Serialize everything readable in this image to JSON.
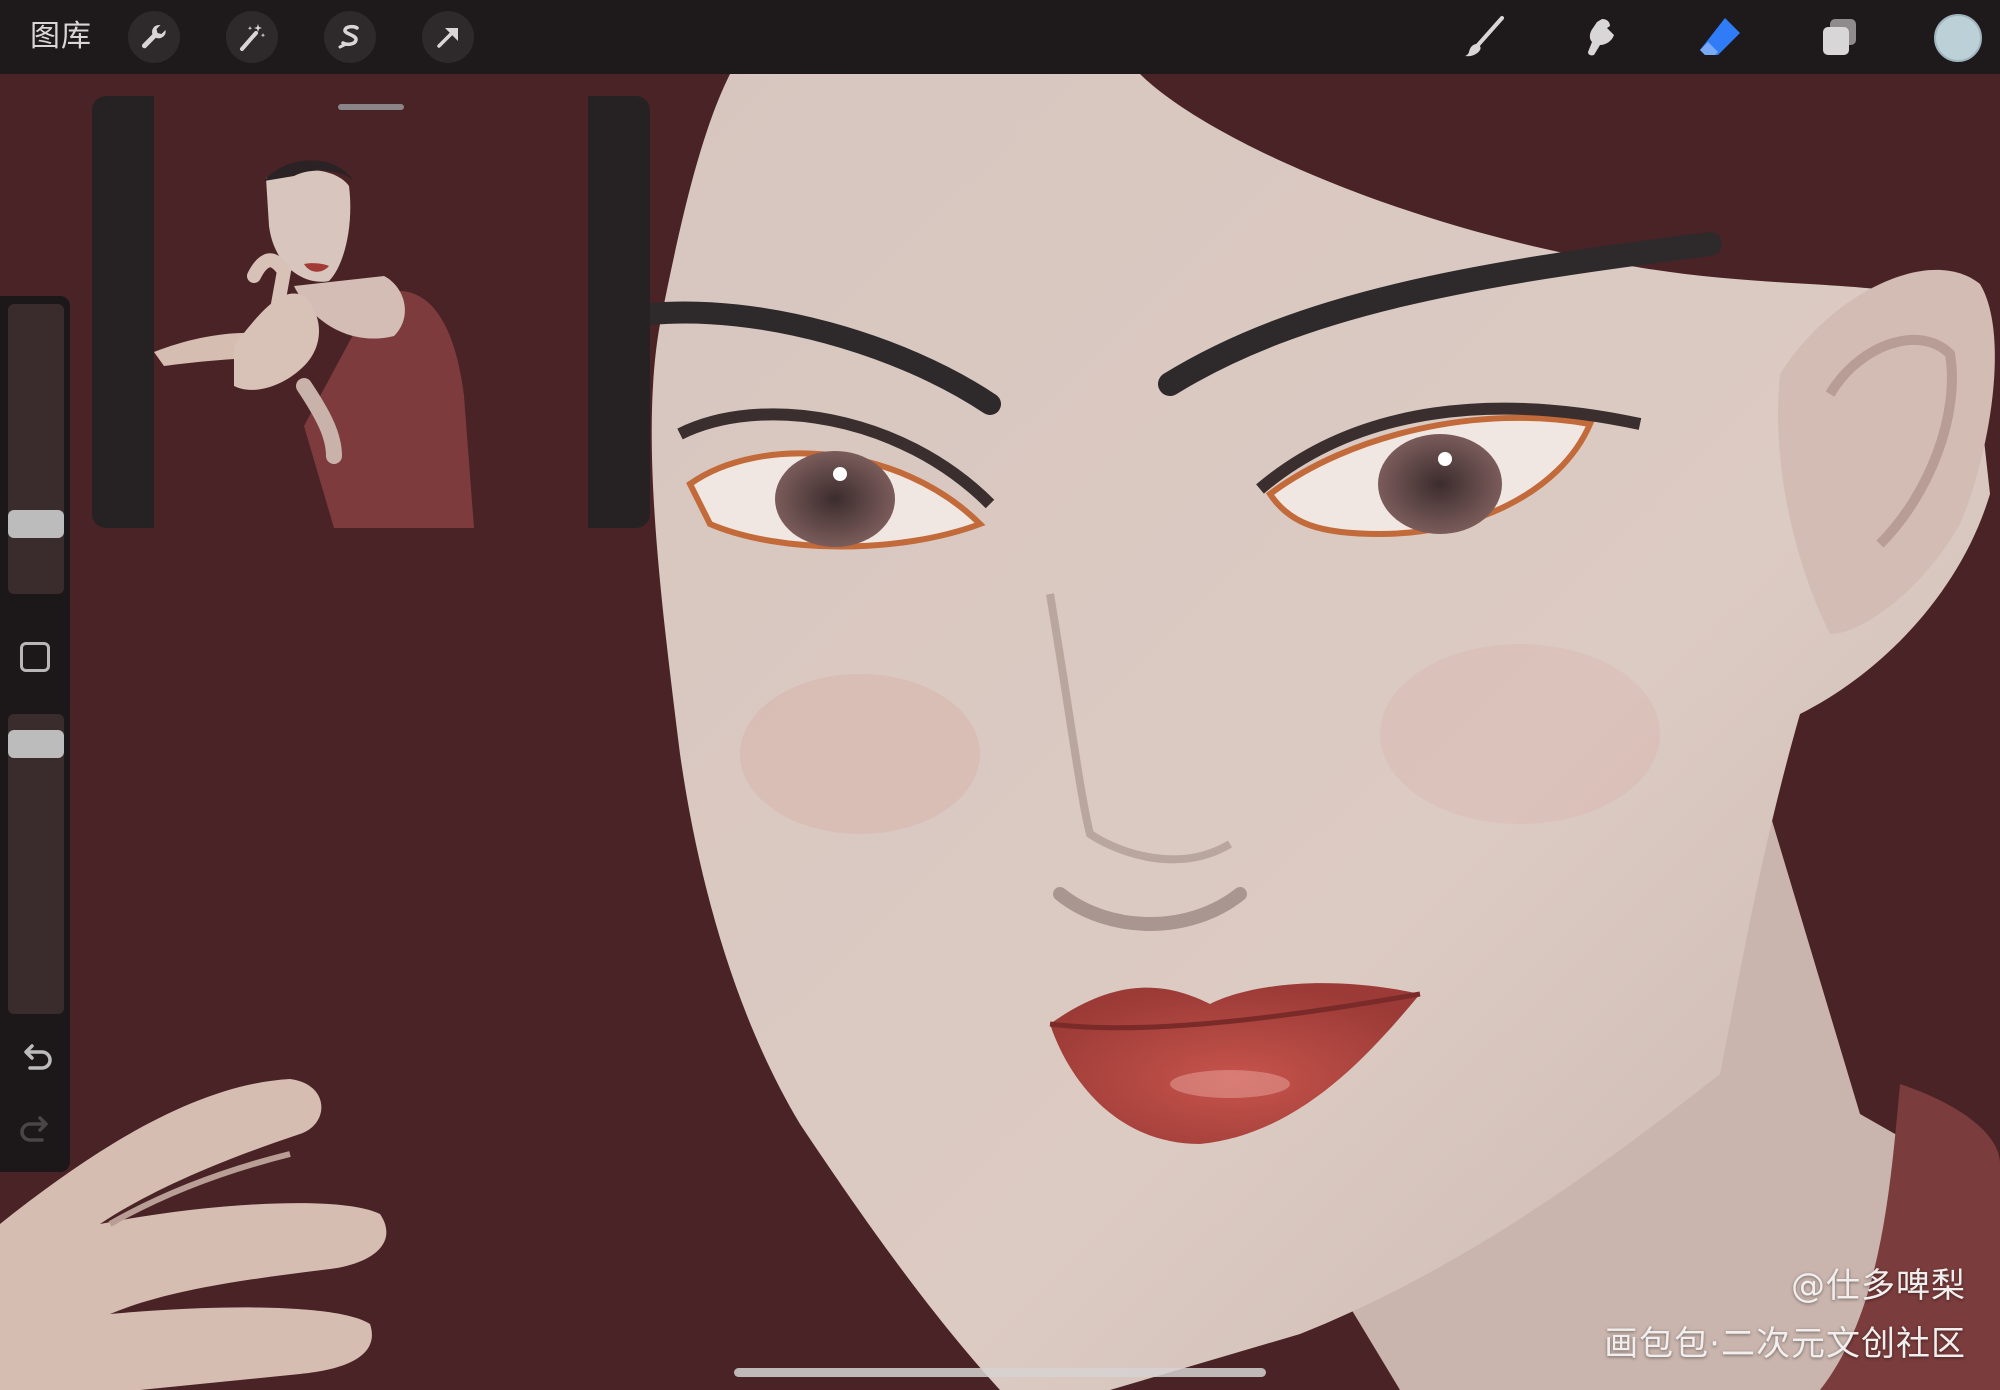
{
  "app": {
    "gallery_label": "图库"
  },
  "toolbar": {
    "left_tools": [
      "wrench-icon",
      "magic-wand-icon",
      "selection-s-icon",
      "move-arrow-icon"
    ],
    "right_tools": [
      "brush-icon",
      "smudge-icon",
      "eraser-icon",
      "layers-icon",
      "color-icon"
    ],
    "active_tool": "eraser",
    "accent": "#2f7cf6",
    "current_color": "#bcd0d8"
  },
  "sidebar": {
    "brush_size_level": 0.24,
    "opacity_level": 0.92,
    "modify_button_icon": "square-icon",
    "undo_icon": "undo-icon",
    "redo_icon": "redo-icon"
  },
  "canvas": {
    "background": "#4a2326"
  },
  "reference": {
    "window_label": "reference-preview"
  },
  "watermark": {
    "author": "@仕多啤梨",
    "site": "画包包·二次元文创社区"
  }
}
